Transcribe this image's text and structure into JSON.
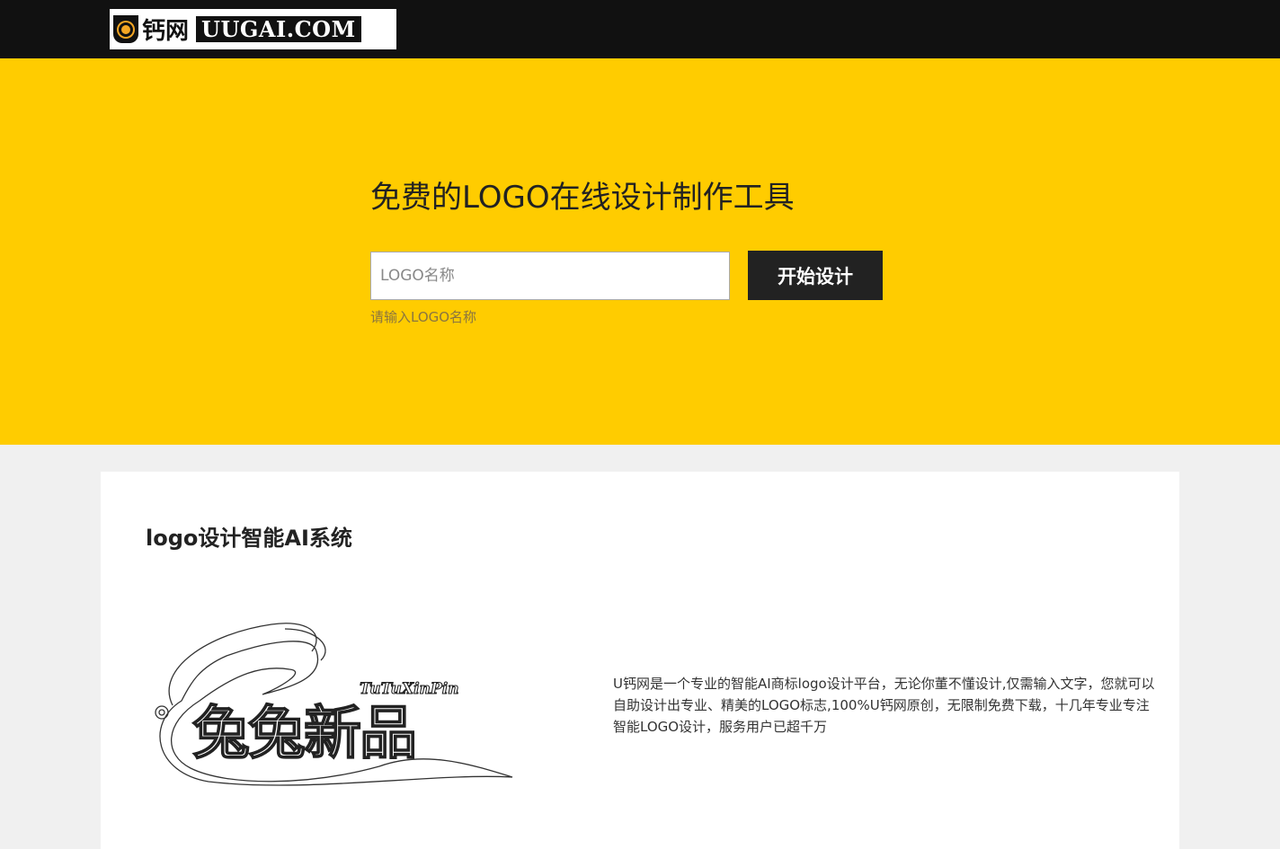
{
  "header": {
    "logo_cn": "钙网",
    "logo_en": "UUGAI.COM"
  },
  "hero": {
    "title": "免费的LOGO在线设计制作工具",
    "input_placeholder": "LOGO名称",
    "input_value": "",
    "button_label": "开始设计",
    "hint": "请输入LOGO名称"
  },
  "section": {
    "title": "logo设计智能AI系统",
    "sample_logo": {
      "text_en": "TuTuXinPin",
      "text_cn": "兔兔新品"
    },
    "description": "U钙网是一个专业的智能AI商标logo设计平台，无论你董不懂设计,仅需输入文字，您就可以自助设计出专业、精美的LOGO标志,100%U钙网原创，无限制免费下载，十几年专业专注智能LOGO设计，服务用户已超千万"
  },
  "colors": {
    "topbar": "#111111",
    "hero_bg": "#ffcc00",
    "button_bg": "#222222",
    "page_bg": "#f0f0f0",
    "card_bg": "#ffffff"
  }
}
